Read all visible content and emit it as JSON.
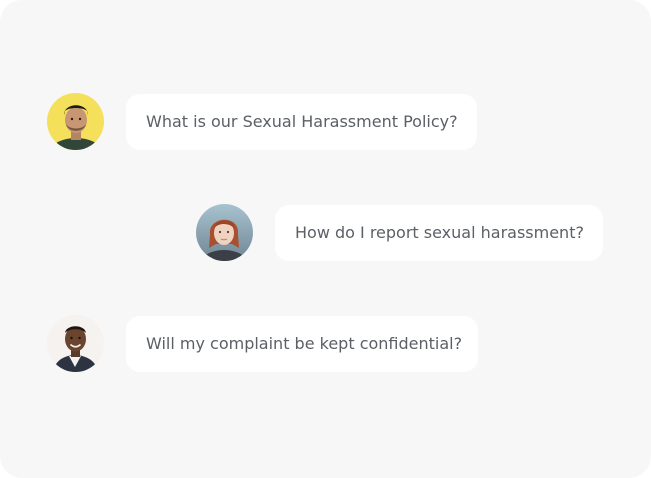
{
  "messages": [
    {
      "text": "What is our Sexual Harassment Policy?",
      "avatar_icon": "man-yellow-background-avatar"
    },
    {
      "text": "How do I report sexual harassment?",
      "avatar_icon": "woman-red-hair-avatar"
    },
    {
      "text": "Will my complaint be kept confidential?",
      "avatar_icon": "man-smiling-avatar"
    }
  ],
  "colors": {
    "panel_background": "#f7f7f7",
    "bubble_background": "#ffffff",
    "text": "#5b5f66"
  }
}
